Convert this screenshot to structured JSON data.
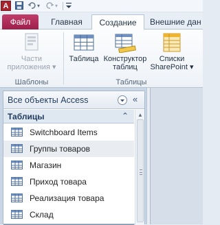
{
  "quick_access": {
    "logo_letter": "A",
    "save_icon": "save-icon",
    "undo_icon": "undo-icon",
    "redo_icon": "redo-icon",
    "customize_icon": "customize-qat-icon"
  },
  "tabs": [
    {
      "label": "Файл"
    },
    {
      "label": "Главная"
    },
    {
      "label": "Создание"
    },
    {
      "label": "Внешние дан"
    }
  ],
  "ribbon": {
    "groups": [
      {
        "label": "Шаблоны",
        "buttons": [
          {
            "label_line1": "Части",
            "label_line2": "приложения ▾",
            "icon": "application-parts-icon"
          }
        ]
      },
      {
        "label": "Таблицы",
        "buttons": [
          {
            "label_line1": "Таблица",
            "label_line2": "",
            "icon": "table-icon"
          },
          {
            "label_line1": "Конструктор",
            "label_line2": "таблиц",
            "icon": "table-design-icon"
          },
          {
            "label_line1": "Списки",
            "label_line2": "SharePoint ▾",
            "icon": "sharepoint-lists-icon"
          }
        ]
      }
    ]
  },
  "nav_pane": {
    "title": "Все объекты Access",
    "collapse_glyph": "«",
    "group_title": "Таблицы",
    "group_chevron": "⌃",
    "items": [
      {
        "label": "Switchboard Items"
      },
      {
        "label": "Группы товаров"
      },
      {
        "label": "Магазин"
      },
      {
        "label": "Приход товара"
      },
      {
        "label": "Реализация товара"
      },
      {
        "label": "Склад"
      }
    ]
  },
  "colors": {
    "file_tab": "#9d1f4b",
    "nav_header_text": "#1f3a5c",
    "selected_row": "#e9edf2"
  }
}
